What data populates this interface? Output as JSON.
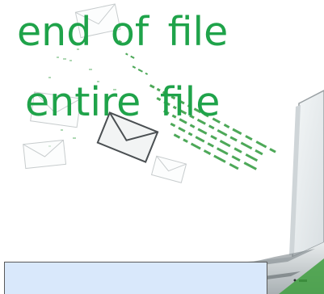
{
  "caption": {
    "line1": "end  of  file",
    "line2": "entire  file"
  },
  "text_box": {
    "value": ""
  },
  "colors": {
    "caption_text": "#1fa34a",
    "text_box_fill": "#d9e8fb",
    "text_box_border": "#5a5a5a",
    "data_stream": "#2e9a3c",
    "background": "#ffffff"
  },
  "icons": [
    "envelope-icon",
    "laptop-icon",
    "data-stream-icon"
  ]
}
